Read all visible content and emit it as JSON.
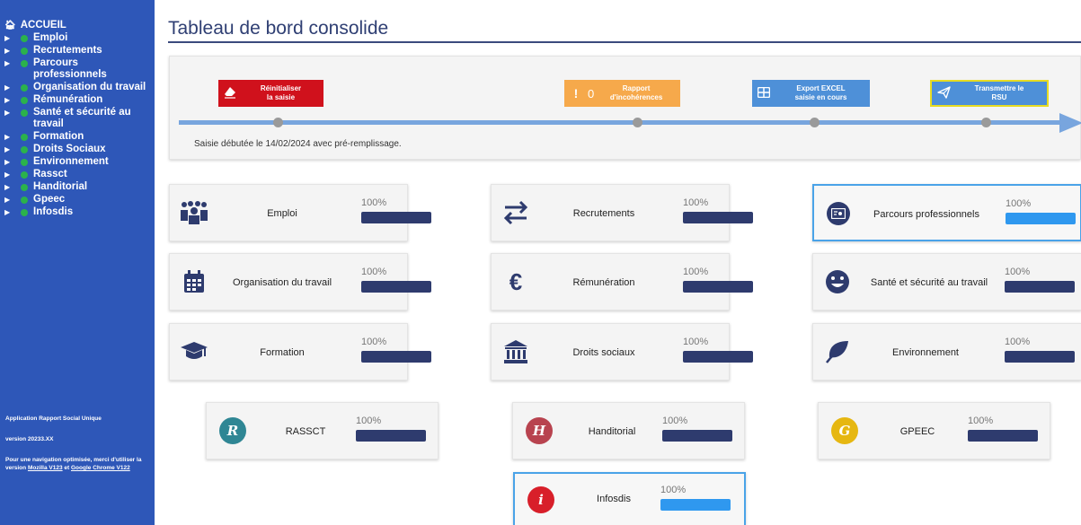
{
  "sidebar": {
    "home_label": "ACCUEIL",
    "items": [
      {
        "label": "Emploi"
      },
      {
        "label": "Recrutements"
      },
      {
        "label": "Parcours professionnels"
      },
      {
        "label": "Organisation du travail"
      },
      {
        "label": "Rémunération"
      },
      {
        "label": "Santé et sécurité au travail"
      },
      {
        "label": "Formation"
      },
      {
        "label": "Droits Sociaux"
      },
      {
        "label": "Environnement"
      },
      {
        "label": "Rassct"
      },
      {
        "label": "Handitorial"
      },
      {
        "label": "Gpeec"
      },
      {
        "label": "Infosdis"
      }
    ],
    "footer": {
      "app_name": "Application Rapport Social Unique",
      "version": "version 20233.XX",
      "nav_note_prefix": "Pour une navigation optimisée, merci d'utiliser la version",
      "mozilla_link": "Mozilla V123",
      "and_text": "et",
      "chrome_link": "Google Chrome V122"
    }
  },
  "page": {
    "title": "Tableau de bord consolide"
  },
  "timeline": {
    "reset_button": {
      "line1": "Réinitialiser",
      "line2": "la saisie"
    },
    "report_button": {
      "count": "0",
      "line1": "Rapport",
      "line2": "d'incohérences"
    },
    "export_button": {
      "line1": "Export EXCEL",
      "line2": "saisie en cours"
    },
    "send_button": {
      "line1": "Transmettre le",
      "line2": "RSU"
    },
    "status": "Saisie débutée le 14/02/2024 avec pré-remplissage.",
    "colors": {
      "reset": "#d0111c",
      "report": "#f6a94b",
      "export": "#4e90d8",
      "line": "#78a5de"
    }
  },
  "cards": [
    {
      "label": "Emploi",
      "percent": "100%",
      "progress": 1.0,
      "icon": "group-icon"
    },
    {
      "label": "Recrutements",
      "percent": "100%",
      "progress": 1.0,
      "icon": "exchange-arrows-icon"
    },
    {
      "label": "Parcours professionnels",
      "percent": "100%",
      "progress": 1.0,
      "icon": "id-card-icon"
    },
    {
      "label": "Organisation du travail",
      "percent": "100%",
      "progress": 1.0,
      "icon": "calendar-icon"
    },
    {
      "label": "Rémunération",
      "percent": "100%",
      "progress": 1.0,
      "icon": "euro-icon"
    },
    {
      "label": "Santé et sécurité au travail",
      "percent": "100%",
      "progress": 1.0,
      "icon": "smiley-icon"
    },
    {
      "label": "Formation",
      "percent": "100%",
      "progress": 1.0,
      "icon": "graduation-cap-icon"
    },
    {
      "label": "Droits sociaux",
      "percent": "100%",
      "progress": 1.0,
      "icon": "bank-icon"
    },
    {
      "label": "Environnement",
      "percent": "100%",
      "progress": 1.0,
      "icon": "leaf-icon"
    },
    {
      "label": "RASSCT",
      "percent": "100%",
      "progress": 1.0,
      "icon": "r-circle-icon",
      "icon_letter": "R",
      "icon_color": "#2f8694"
    },
    {
      "label": "Handitorial",
      "percent": "100%",
      "progress": 1.0,
      "icon": "h-circle-icon",
      "icon_letter": "H",
      "icon_color": "#b8434f"
    },
    {
      "label": "GPEEC",
      "percent": "100%",
      "progress": 1.0,
      "icon": "g-circle-icon",
      "icon_letter": "G",
      "icon_color": "#e6b711"
    },
    {
      "label": "Infosdis",
      "percent": "100%",
      "progress": 1.0,
      "icon": "info-circle-icon",
      "icon_letter": "i",
      "icon_color": "#d81f2a"
    }
  ],
  "colors": {
    "sidebar_bg": "#2e57b8",
    "bar_default": "#2e3b6e",
    "bar_active": "#2f98ef",
    "active_border": "#4aa3e8"
  }
}
